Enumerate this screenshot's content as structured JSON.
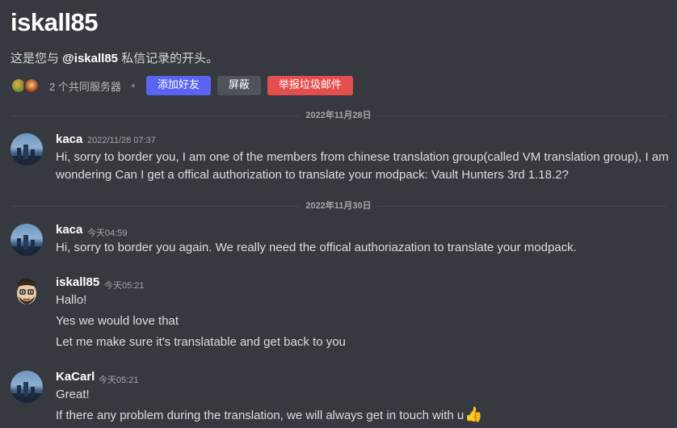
{
  "header": {
    "title": "iskall85",
    "subtitle_prefix": "这是您与 ",
    "subtitle_handle": "@iskall85",
    "subtitle_suffix": " 私信记录的开头。",
    "mutual_servers": "2 个共同服务器",
    "buttons": {
      "add_friend": "添加好友",
      "block": "屏蔽",
      "report_spam": "举报垃圾邮件"
    }
  },
  "dividers": [
    "2022年11月28日",
    "2022年11月30日"
  ],
  "messages": [
    {
      "author": "kaca",
      "time": "2022/11/28 07:37",
      "avatar": "city-skyline-avatar",
      "lines": [
        "Hi, sorry to border you, I am one of the members from chinese translation group(called VM translation group), I am",
        "wondering Can I get a  offical authorization to translate your modpack: Vault Hunters 3rd 1.18.2?"
      ]
    },
    {
      "author": "kaca",
      "time": "今天04:59",
      "avatar": "city-skyline-avatar",
      "lines": [
        "Hi, sorry to border you again. We really need the offical authoriazation to translate your modpack."
      ]
    },
    {
      "author": "iskall85",
      "time": "今天05:21",
      "avatar": "cartoon-face-avatar",
      "lines": [
        "Hallo!",
        "Yes we would love that",
        "Let me make sure it's translatable and get back to you"
      ]
    },
    {
      "author": "KaCarl",
      "time": "今天05:21",
      "avatar": "city-skyline-avatar",
      "lines": [
        "Great!",
        "If there any problem during the translation, we will always get in touch with u"
      ]
    }
  ],
  "colors": {
    "background": "#36393f",
    "blurple": "#5865f2",
    "danger": "#e34e4e"
  }
}
